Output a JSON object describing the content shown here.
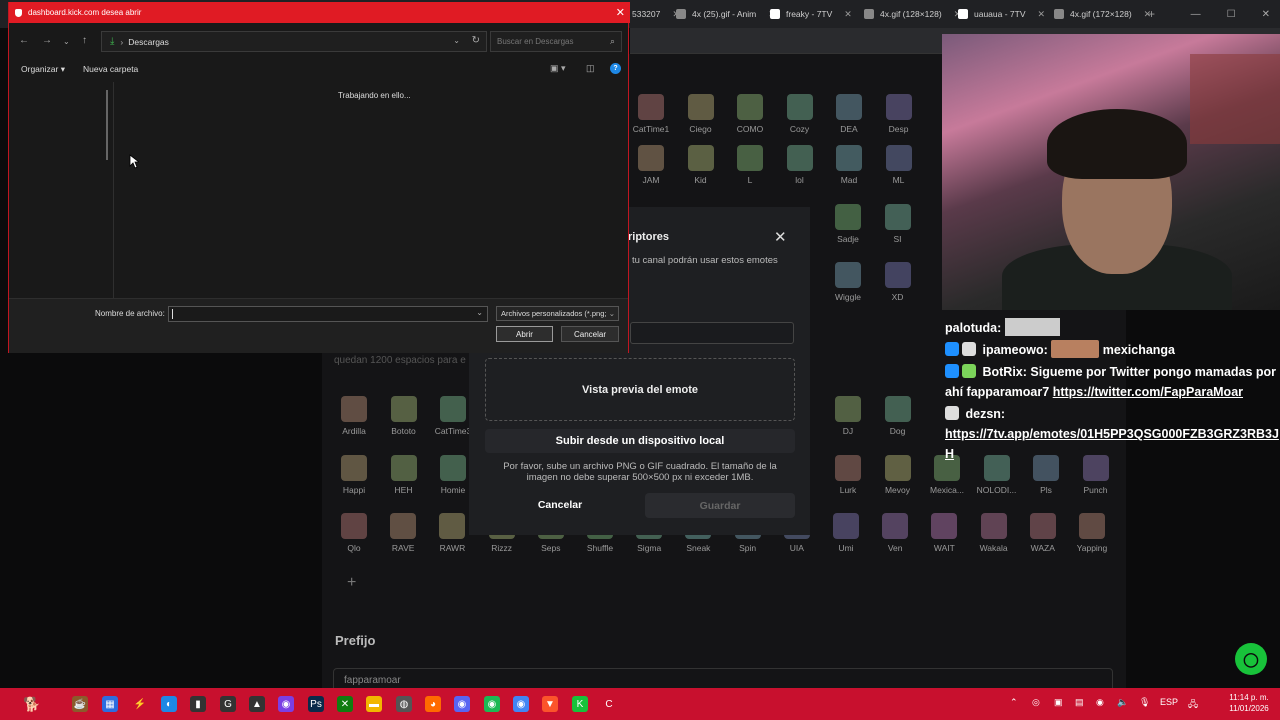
{
  "browser": {
    "tabs": [
      {
        "label": "533207",
        "x": "partial"
      },
      {
        "label": "4x (25).gif - Anim"
      },
      {
        "label": "freaky - 7TV"
      },
      {
        "label": "4x.gif (128×128)"
      },
      {
        "label": "uauaua - 7TV"
      },
      {
        "label": "4x.gif (172×128)"
      }
    ],
    "new_tab": "+"
  },
  "file_dialog": {
    "title": "dashboard.kick.com desea abrir",
    "path": "Descargas",
    "search_placeholder": "Buscar en Descargas",
    "organize": "Organizar",
    "new_folder": "Nueva carpeta",
    "status": "Trabajando en ello...",
    "filename_label": "Nombre de archivo:",
    "filename_value": "",
    "filter": "Archivos personalizados (*.png;",
    "open": "Abrir",
    "cancel": "Cancelar",
    "help": "?"
  },
  "dashboard": {
    "emote_rows": [
      [
        "CatTime1",
        "Ciego",
        "COMO",
        "Cozy",
        "DEA",
        "Desp"
      ],
      [
        "JAM",
        "Kid",
        "L",
        "lol",
        "Mad",
        "ML"
      ],
      [
        "Sadje",
        "SI",
        "Wiggle",
        "XD"
      ]
    ],
    "emotes_row_a": [
      "Ardilla",
      "Bototo",
      "CatTime3"
    ],
    "emotes_row_a_right": [
      "DJ",
      "Dog"
    ],
    "emotes_row_b": [
      "Happi",
      "HEH",
      "Homie"
    ],
    "emotes_row_b_right": [
      "Lurk",
      "Mevoy",
      "Mexica...",
      "NOLODI...",
      "Pls",
      "Punch"
    ],
    "emotes_row_c": [
      "Qlo",
      "RAVE",
      "RAWR",
      "Rizzz",
      "Seps",
      "Shuffle",
      "Sigma",
      "Sneak",
      "Spin",
      "UIA",
      "Umi",
      "Ven",
      "WAIT",
      "Wakala",
      "WAZA",
      "Yapping"
    ],
    "slots_text": "quedan 1200 espacios para e",
    "prefix_title": "Prefijo",
    "prefix_value": "fapparamoar"
  },
  "modal": {
    "title": "riptores",
    "subtitle": "tu canal podrán usar estos emotes",
    "preview": "Vista previa del emote",
    "upload": "Subir desde un dispositivo local",
    "hint": "Por favor, sube un archivo PNG o GIF cuadrado. El tamaño de la imagen no debe superar 500×500 px ni exceder 1MB.",
    "cancel": "Cancelar",
    "save": "Guardar"
  },
  "chat": [
    {
      "user": "palotuda:",
      "text": ""
    },
    {
      "user": "ipameowo:",
      "text": "mexichanga"
    },
    {
      "user": "BotRix:",
      "text": "Sigueme por Twitter pongo mamadas por ahí fapparamoar7",
      "link": "https://twitter.com/FapParaMoar"
    },
    {
      "user": "dezsn:",
      "text": "",
      "link": "https://7tv.app/emotes/01H5PP3QSG000FZB3GRZ3RB3JH"
    }
  ],
  "taskbar": {
    "lang": "ESP",
    "time": "11:14 p. m.",
    "date": "11/01/2026"
  },
  "colors": {
    "taskbar": "#c8102e",
    "dialog_title": "#e01b24",
    "kick_green": "#18c23a"
  }
}
